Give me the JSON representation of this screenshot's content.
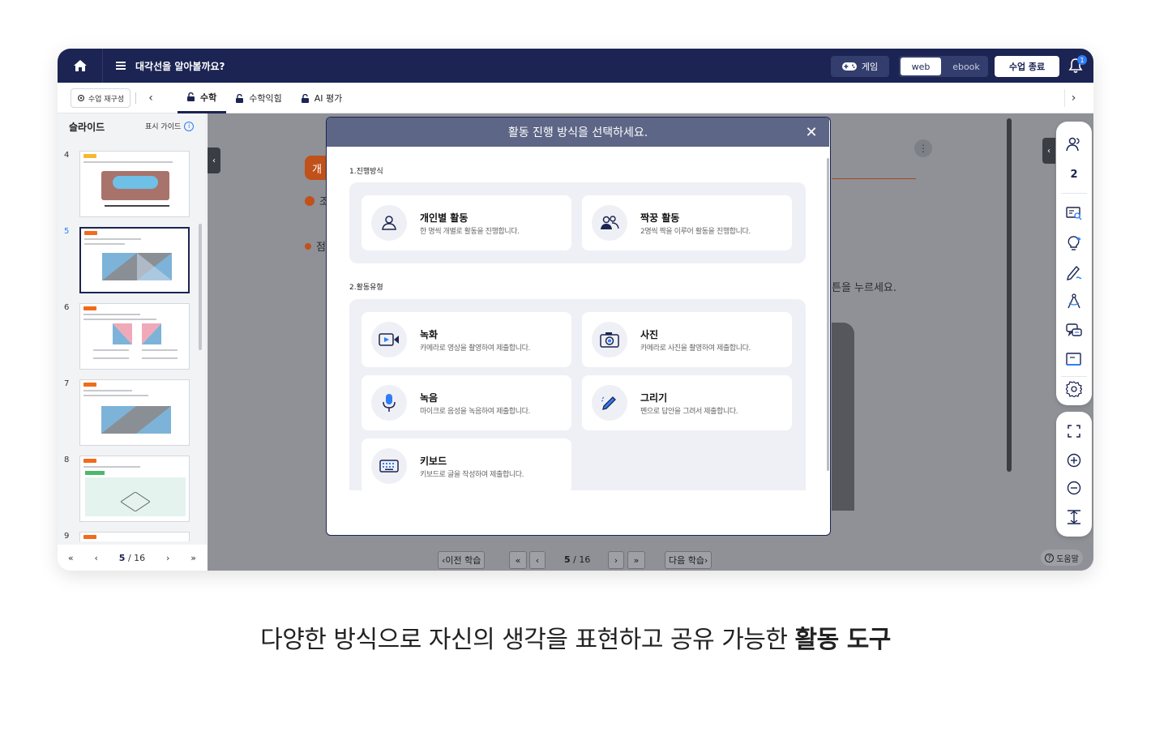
{
  "topbar": {
    "title": "대각선을 알아볼까요?",
    "game_label": "게임",
    "web_label": "web",
    "ebook_label": "ebook",
    "end_label": "수업 종료",
    "notification_count": "1"
  },
  "subbar": {
    "reconfigure_label": "수업 재구성",
    "tabs": [
      {
        "label": "수학"
      },
      {
        "label": "수학익힘"
      },
      {
        "label": "AI 평가"
      }
    ]
  },
  "sidebar": {
    "title": "슬라이드",
    "guide_label": "표시 가이드",
    "slides": [
      {
        "num": "4"
      },
      {
        "num": "5"
      },
      {
        "num": "6"
      },
      {
        "num": "7"
      },
      {
        "num": "8"
      },
      {
        "num": "9"
      }
    ],
    "pager": {
      "current": "5",
      "total": "16",
      "sep": "/"
    }
  },
  "background": {
    "pill_text": "개",
    "line1": "조",
    "line2": "점",
    "hint": "튼을 누르세요."
  },
  "right_tools": {
    "participant_count": "2"
  },
  "bottom": {
    "prev_label": "이전 학습",
    "next_label": "다음 학습",
    "page_current": "5",
    "page_total": "16",
    "page_sep": "/",
    "help_label": "도움말"
  },
  "modal": {
    "title": "활동 진행 방식을 선택하세요.",
    "section1": "1.진행방식",
    "section2": "2.활동유형",
    "modes": [
      {
        "title": "개인별 활동",
        "desc": "한 명씩 개별로 활동을 진행합니다."
      },
      {
        "title": "짝꿍 활동",
        "desc": "2명씩 짝을 이루어 활동을 진행합니다."
      }
    ],
    "types": [
      {
        "title": "녹화",
        "desc": "카메라로 영상을 촬영하여 제출합니다."
      },
      {
        "title": "사진",
        "desc": "카메라로 사진을 촬영하여 제출합니다."
      },
      {
        "title": "녹음",
        "desc": "마이크로 음성을 녹음하여 제출합니다."
      },
      {
        "title": "그리기",
        "desc": "펜으로 답안을 그려서 제출합니다."
      },
      {
        "title": "키보드",
        "desc": "키보드로 글을 작성하여 제출합니다."
      }
    ]
  },
  "caption": {
    "normal": "다양한 방식으로 자신의 생각을 표현하고 공유 가능한 ",
    "bold": "활동 도구"
  },
  "colors": {
    "navy": "#1b2452",
    "accent_orange": "#f26b1d",
    "blue": "#2f7df6"
  }
}
